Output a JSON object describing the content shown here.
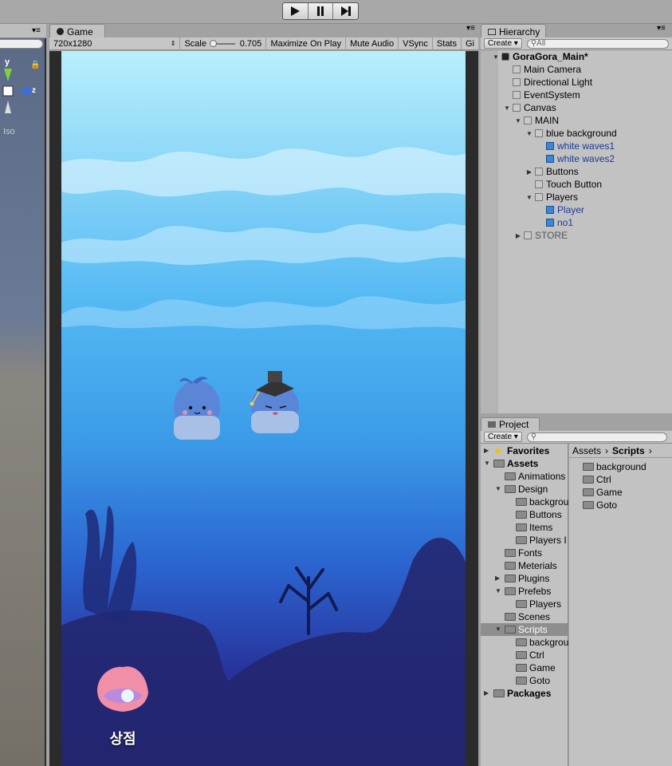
{
  "toolbar": {
    "play_icon": "play-icon",
    "pause_icon": "pause-icon",
    "step_icon": "step-icon"
  },
  "scene": {
    "axis_y": "y",
    "axis_z": "z",
    "projection": "Iso"
  },
  "game": {
    "tab_label": "Game",
    "resolution": "720x1280",
    "scale_label": "Scale",
    "scale_value": "0.705",
    "maximize_label": "Maximize On Play",
    "mute_label": "Mute Audio",
    "vsync_label": "VSync",
    "stats_label": "Stats",
    "gizmos_label": "Gi",
    "store_label": "상점"
  },
  "hierarchy": {
    "tab_label": "Hierarchy",
    "create_label": "Create",
    "search_placeholder": "All",
    "items": [
      {
        "label": "GoraGora_Main*",
        "depth": 0,
        "arrow": "down",
        "scene": true
      },
      {
        "label": "Main Camera",
        "depth": 1,
        "arrow": ""
      },
      {
        "label": "Directional Light",
        "depth": 1,
        "arrow": ""
      },
      {
        "label": "EventSystem",
        "depth": 1,
        "arrow": ""
      },
      {
        "label": "Canvas",
        "depth": 1,
        "arrow": "down"
      },
      {
        "label": "MAIN",
        "depth": 2,
        "arrow": "down"
      },
      {
        "label": "blue background",
        "depth": 3,
        "arrow": "down"
      },
      {
        "label": "white waves1",
        "depth": 4,
        "arrow": "",
        "blue": true
      },
      {
        "label": "white waves2",
        "depth": 4,
        "arrow": "",
        "blue": true
      },
      {
        "label": "Buttons",
        "depth": 3,
        "arrow": "right"
      },
      {
        "label": "Touch Button",
        "depth": 3,
        "arrow": ""
      },
      {
        "label": "Players",
        "depth": 3,
        "arrow": "down"
      },
      {
        "label": "Player",
        "depth": 4,
        "arrow": "",
        "blue": true
      },
      {
        "label": "no1",
        "depth": 4,
        "arrow": "",
        "blue": true
      },
      {
        "label": "STORE",
        "depth": 2,
        "arrow": "right",
        "dim": true
      }
    ]
  },
  "project": {
    "tab_label": "Project",
    "create_label": "Create",
    "breadcrumb_root": "Assets",
    "breadcrumb_current": "Scripts",
    "tree": [
      {
        "label": "Favorites",
        "depth": 0,
        "arrow": "right",
        "bold": true,
        "star": true
      },
      {
        "label": "Assets",
        "depth": 0,
        "arrow": "down",
        "bold": true
      },
      {
        "label": "Animations",
        "depth": 1,
        "arrow": ""
      },
      {
        "label": "Design",
        "depth": 1,
        "arrow": "down"
      },
      {
        "label": "backgrou",
        "depth": 2,
        "arrow": ""
      },
      {
        "label": "Buttons",
        "depth": 2,
        "arrow": ""
      },
      {
        "label": "Items",
        "depth": 2,
        "arrow": ""
      },
      {
        "label": "Players I",
        "depth": 2,
        "arrow": ""
      },
      {
        "label": "Fonts",
        "depth": 1,
        "arrow": ""
      },
      {
        "label": "Meterials",
        "depth": 1,
        "arrow": ""
      },
      {
        "label": "Plugins",
        "depth": 1,
        "arrow": "right"
      },
      {
        "label": "Prefebs",
        "depth": 1,
        "arrow": "down"
      },
      {
        "label": "Players",
        "depth": 2,
        "arrow": ""
      },
      {
        "label": "Scenes",
        "depth": 1,
        "arrow": ""
      },
      {
        "label": "Scripts",
        "depth": 1,
        "arrow": "down",
        "selected": true
      },
      {
        "label": "backgrou",
        "depth": 2,
        "arrow": ""
      },
      {
        "label": "Ctrl",
        "depth": 2,
        "arrow": ""
      },
      {
        "label": "Game",
        "depth": 2,
        "arrow": ""
      },
      {
        "label": "Goto",
        "depth": 2,
        "arrow": ""
      },
      {
        "label": "Packages",
        "depth": 0,
        "arrow": "right",
        "bold": true
      }
    ],
    "contents": [
      "background",
      "Ctrl",
      "Game",
      "Goto"
    ]
  }
}
